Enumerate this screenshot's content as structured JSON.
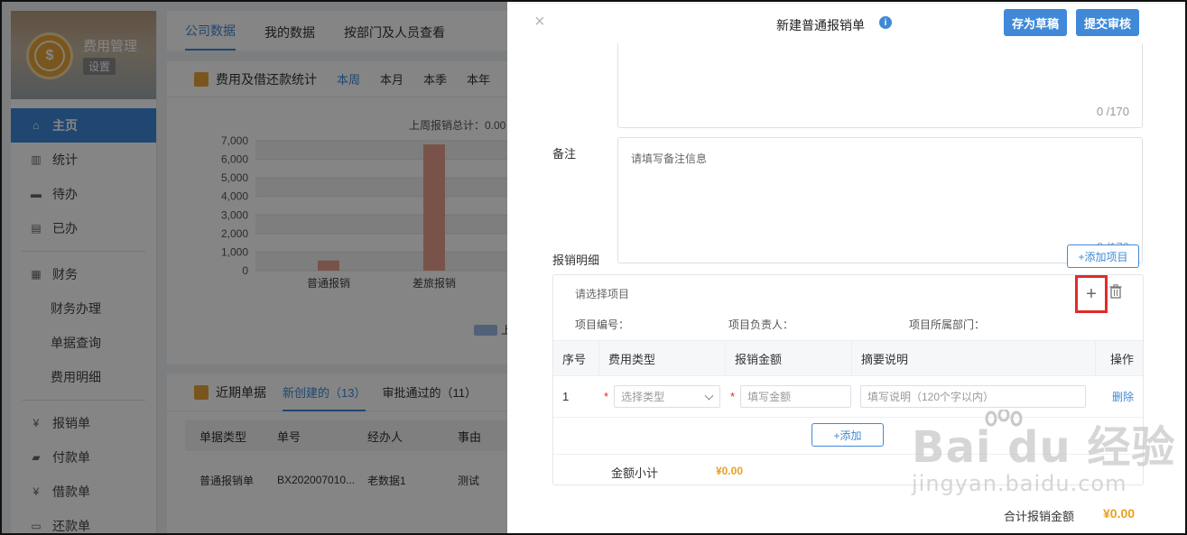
{
  "sidebar": {
    "title": "费用管理",
    "settings": "设置",
    "items": [
      {
        "label": "主页",
        "icon": "home-icon"
      },
      {
        "label": "统计",
        "icon": "bar-chart-icon"
      },
      {
        "label": "待办",
        "icon": "todo-icon"
      },
      {
        "label": "已办",
        "icon": "done-icon"
      },
      {
        "label": "财务",
        "icon": "finance-icon"
      },
      {
        "label": "财务办理"
      },
      {
        "label": "单据查询"
      },
      {
        "label": "费用明细"
      },
      {
        "label": "报销单",
        "icon": "yen-receipt-icon"
      },
      {
        "label": "付款单",
        "icon": "wallet-icon"
      },
      {
        "label": "借款单",
        "icon": "loan-icon"
      },
      {
        "label": "还款单",
        "icon": "repay-icon"
      }
    ]
  },
  "main": {
    "tabs": [
      "公司数据",
      "我的数据",
      "按部门及人员查看"
    ],
    "stats_title": "费用及借还款统计",
    "periods": [
      "本周",
      "本月",
      "本季",
      "本年"
    ],
    "summary": "上周报销总计：0.00",
    "legend": "上",
    "recent_title": "近期单据",
    "recent_tabs": [
      "新创建的（13）",
      "审批通过的（11）"
    ],
    "table_headers": [
      "单据类型",
      "单号",
      "经办人",
      "事由"
    ],
    "table_row": [
      "普通报销单",
      "BX202007010...",
      "老数据1",
      "测试"
    ]
  },
  "chart_data": {
    "type": "bar",
    "categories": [
      "普通报销",
      "差旅报销"
    ],
    "values": [
      550,
      6800
    ],
    "ylim": [
      0,
      7000
    ],
    "yticks": [
      "7,000",
      "6,000",
      "5,000",
      "4,000",
      "3,000",
      "2,000",
      "1,000",
      "0"
    ],
    "bar_color": "#e9a08f",
    "grid": true
  },
  "drawer": {
    "close": "×",
    "title": "新建普通报销单",
    "info": "i",
    "save_draft": "存为草稿",
    "submit": "提交审核",
    "counter1": "0 /170",
    "remark_label": "备注",
    "remark_placeholder": "请填写备注信息",
    "counter2": "0 /170",
    "detail_label": "报销明细",
    "add_item": "+添加项目",
    "project_placeholder": "请选择项目",
    "plus": "+",
    "project_no": "项目编号：",
    "project_owner": "项目负责人：",
    "project_dept": "项目所属部门：",
    "columns": [
      "序号",
      "费用类型",
      "报销金额",
      "摘要说明",
      "操作"
    ],
    "row": {
      "index": "1",
      "type_placeholder": "选择类型",
      "amount_placeholder": "填写金额",
      "desc_placeholder": "填写说明（120个字以内）",
      "delete": "删除"
    },
    "add_row": "+添加",
    "subtotal_label": "金额小计",
    "subtotal_value": "¥0.00",
    "total_label": "合计报销金额",
    "total_value": "¥0.00"
  },
  "watermark": {
    "brand": "Bai du 经验",
    "url": "jingyan.baidu.com"
  },
  "colors": {
    "accent": "#3f89d8",
    "highlight_box": "#e22b2b",
    "amount": "#e8a022"
  }
}
